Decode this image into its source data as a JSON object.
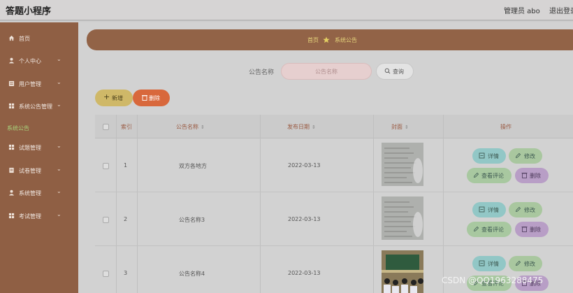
{
  "app": {
    "title": "答题小程序"
  },
  "topbar": {
    "user": "管理员 abo",
    "logout": "退出登录"
  },
  "sidebar": {
    "items": [
      {
        "label": "首页",
        "icon": "home-icon",
        "chevron": false
      },
      {
        "label": "个人中心",
        "icon": "user-icon",
        "chevron": true
      },
      {
        "label": "用户管理",
        "icon": "list-icon",
        "chevron": true
      },
      {
        "label": "系统公告管理",
        "icon": "grid-icon",
        "chevron": true
      },
      {
        "label": "系统公告",
        "icon": "",
        "chevron": false,
        "sub": true,
        "active": true
      },
      {
        "label": "试题管理",
        "icon": "grid-icon",
        "chevron": true
      },
      {
        "label": "试卷管理",
        "icon": "doc-icon",
        "chevron": true
      },
      {
        "label": "系统管理",
        "icon": "user-icon",
        "chevron": true
      },
      {
        "label": "考试管理",
        "icon": "grid-icon",
        "chevron": true
      }
    ],
    "chevron_glyph": "⌄"
  },
  "breadcrumb": {
    "home": "首页",
    "current": "系统公告"
  },
  "search": {
    "label": "公告名称",
    "placeholder": "公告名称",
    "button": "查询"
  },
  "toolbar": {
    "add": "+ 新增",
    "add_text": "新增",
    "delete": "删除"
  },
  "table": {
    "headers": {
      "index": "索引",
      "name": "公告名称",
      "date": "发布日期",
      "cover": "封面",
      "actions": "操作"
    },
    "rows": [
      {
        "index": "1",
        "name": "双方各地方",
        "date": "2022-03-13",
        "cover": "handwritten-paper"
      },
      {
        "index": "2",
        "name": "公告名称3",
        "date": "2022-03-13",
        "cover": "handwritten-paper"
      },
      {
        "index": "3",
        "name": "公告名称4",
        "date": "2022-03-13",
        "cover": "classroom-photo"
      }
    ],
    "actions": {
      "detail": "详情",
      "edit": "修改",
      "review": "查看评论",
      "delete": "删除"
    }
  },
  "watermark": "CSDN @QQ1963288475",
  "colors": {
    "sidebar": "#8f5f44",
    "breadcrumb": "#926347",
    "add": "#cfb868",
    "delete": "#d8683c",
    "active_sub": "#a8d47c"
  }
}
